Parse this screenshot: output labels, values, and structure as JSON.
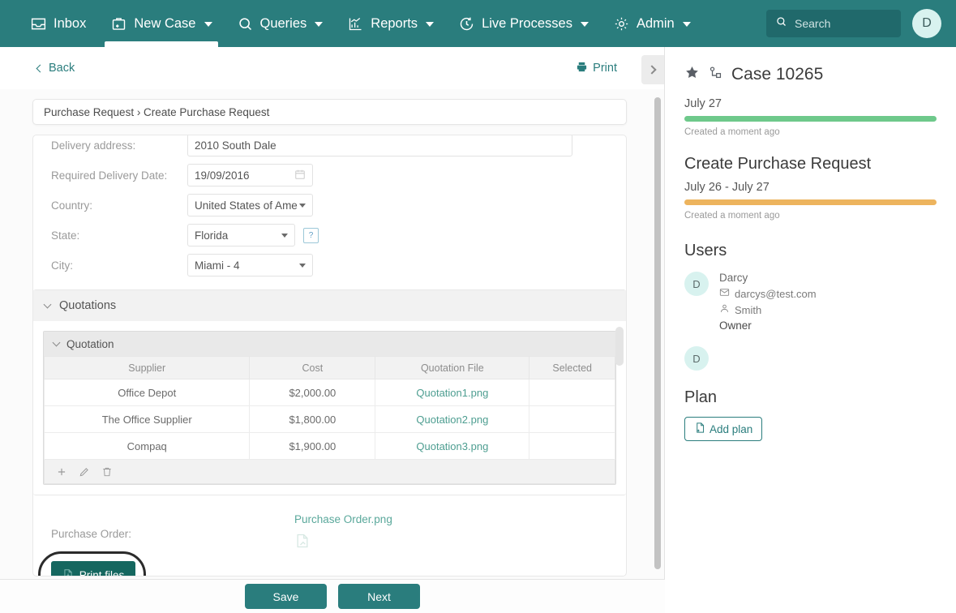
{
  "nav": {
    "items": [
      {
        "label": "Inbox",
        "icon": "inbox-icon",
        "caret": false,
        "active": false
      },
      {
        "label": "New Case",
        "icon": "briefcase-plus-icon",
        "caret": true,
        "active": true
      },
      {
        "label": "Queries",
        "icon": "search-icon",
        "caret": true,
        "active": false
      },
      {
        "label": "Reports",
        "icon": "chart-icon",
        "caret": true,
        "active": false
      },
      {
        "label": "Live Processes",
        "icon": "clock-arrow-icon",
        "caret": true,
        "active": false
      },
      {
        "label": "Admin",
        "icon": "gear-icon",
        "caret": true,
        "active": false
      }
    ],
    "search_placeholder": "Search",
    "avatar_initial": "D",
    "brand_color": "#2a7d7d"
  },
  "toolbar": {
    "back_label": "Back",
    "print_label": "Print"
  },
  "breadcrumb": {
    "text": "Purchase Request › Create Purchase Request"
  },
  "form": {
    "fields": [
      {
        "label": "Delivery address:",
        "value": "2010 South Dale",
        "type": "text"
      },
      {
        "label": "Required Delivery Date:",
        "value": "19/09/2016",
        "type": "date"
      },
      {
        "label": "Country:",
        "value": "United States of Ame",
        "type": "select"
      },
      {
        "label": "State:",
        "value": "Florida",
        "type": "select",
        "help": "?"
      },
      {
        "label": "City:",
        "value": "Miami - 4",
        "type": "select"
      }
    ]
  },
  "quotations": {
    "section_title": "Quotations",
    "subsection_title": "Quotation",
    "columns": [
      "Supplier",
      "Cost",
      "Quotation File",
      "Selected"
    ],
    "rows": [
      {
        "supplier": "Office Depot",
        "cost": "$2,000.00",
        "file": "Quotation1.png",
        "selected": ""
      },
      {
        "supplier": "The Office Supplier",
        "cost": "$1,800.00",
        "file": "Quotation2.png",
        "selected": ""
      },
      {
        "supplier": "Compaq",
        "cost": "$1,900.00",
        "file": "Quotation3.png",
        "selected": ""
      }
    ],
    "actions": [
      "add-icon",
      "edit-icon",
      "delete-icon"
    ]
  },
  "purchase_order": {
    "label": "Purchase Order:",
    "file": "Purchase Order.png",
    "print_files_label": "Print files"
  },
  "footer": {
    "save_label": "Save",
    "next_label": "Next"
  },
  "sidebar": {
    "case_title": "Case 10265",
    "case_date": "July 27",
    "case_bar_color": "#6ec98b",
    "case_note": "Created a moment ago",
    "stage_title": "Create Purchase Request",
    "stage_date": "July 26 - July 27",
    "stage_bar_color": "#edb45e",
    "stage_note": "Created a moment ago",
    "users_title": "Users",
    "users": [
      {
        "initial": "D",
        "name": "Darcy",
        "email": "darcys@test.com",
        "surname": "Smith",
        "role": "Owner"
      },
      {
        "initial": "D",
        "name": "",
        "email": "",
        "surname": "",
        "role": ""
      }
    ],
    "plan_title": "Plan",
    "add_plan_label": "Add plan"
  }
}
